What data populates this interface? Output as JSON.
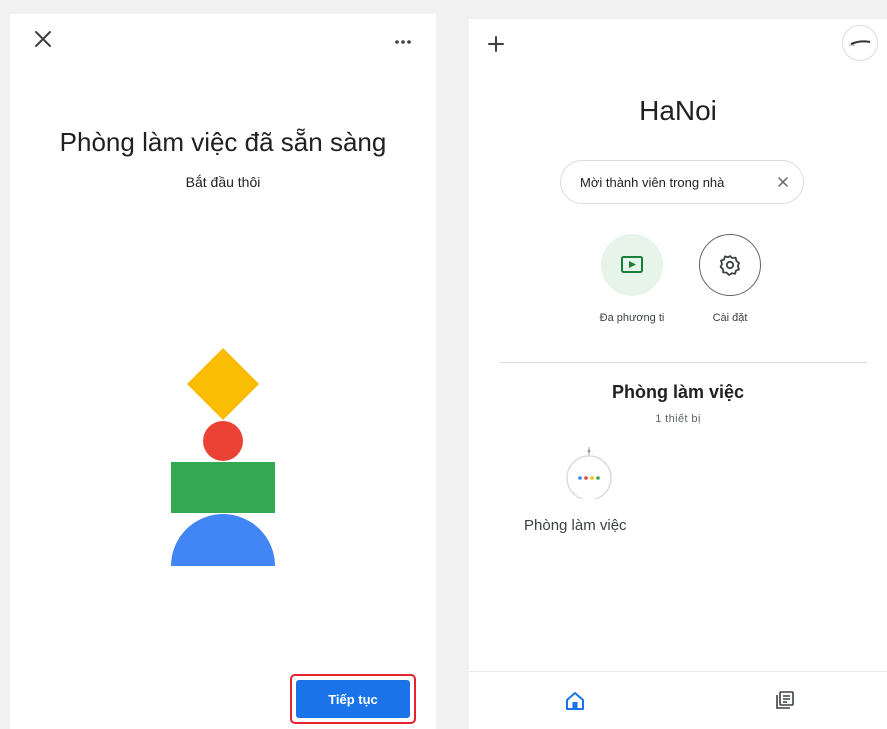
{
  "setup_screen": {
    "title": "Phòng làm việc đã sẵn sàng",
    "subtitle": "Bắt đầu thôi",
    "continue_label": "Tiếp tục",
    "icons": {
      "close": "close-icon",
      "more": "more-horiz-icon"
    },
    "illustration_colors": {
      "diamond": "#fbbc04",
      "circle": "#ea4335",
      "rectangle": "#34a853",
      "dome": "#4285f4"
    }
  },
  "home_screen": {
    "title": "HaNoi",
    "invite_chip_label": "Mời thành viên trong nhà",
    "actions": [
      {
        "label": "Đa phương ti",
        "icon": "media-play-icon"
      },
      {
        "label": "Cài đặt",
        "icon": "gear-icon"
      }
    ],
    "room": {
      "name": "Phòng làm việc",
      "device_count_label": "1 thiết bị",
      "devices": [
        {
          "label": "Phòng làm việc",
          "icon": "smart-speaker-icon"
        }
      ]
    },
    "bottom_nav": [
      {
        "icon": "home-icon",
        "active": true
      },
      {
        "icon": "feed-icon",
        "active": false
      }
    ],
    "accent_color": "#1a73e8"
  }
}
